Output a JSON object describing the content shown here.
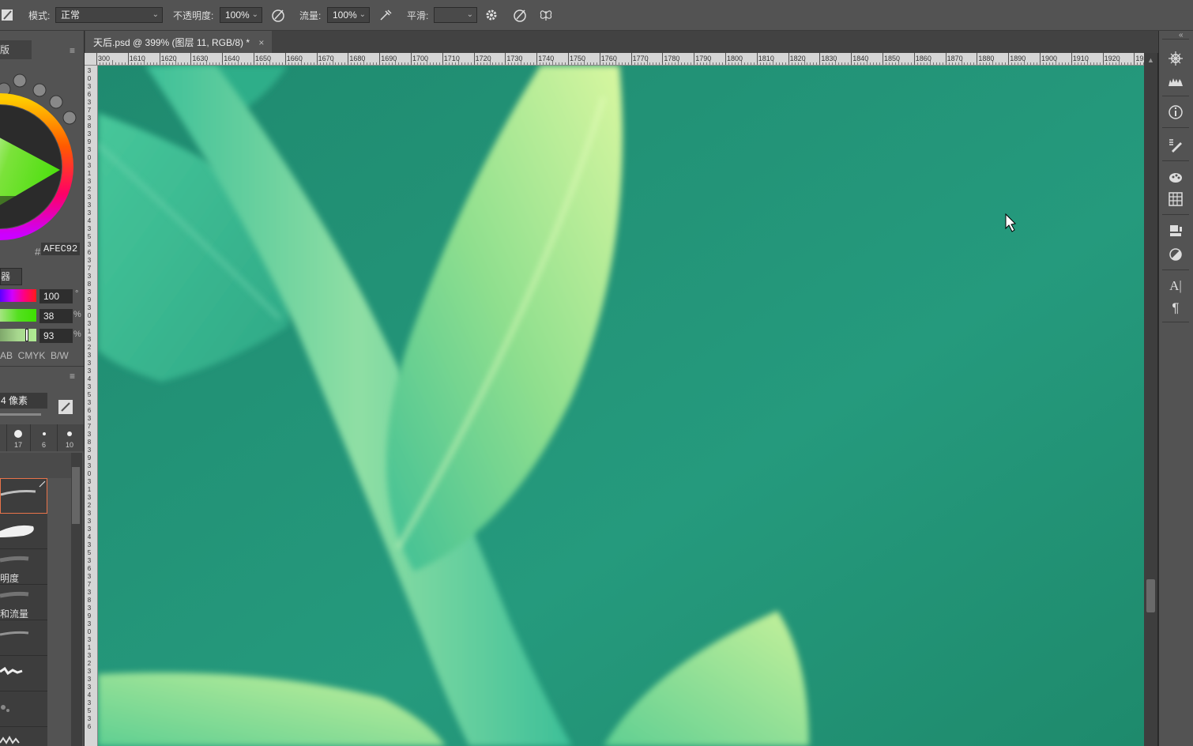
{
  "options_bar": {
    "mode_label": "模式:",
    "mode_value": "正常",
    "opacity_label": "不透明度:",
    "opacity_value": "100%",
    "flow_label": "流量:",
    "flow_value": "100%",
    "smoothing_label": "平滑:",
    "smoothing_value": ""
  },
  "document_tab": {
    "title": "天后.psd @ 399% (图层 11, RGB/8) *",
    "close": "×"
  },
  "ruler": {
    "h_labels": [
      "300",
      "1610",
      "1620",
      "1630",
      "1640",
      "1650",
      "1660",
      "1670",
      "1680",
      "1690",
      "1700",
      "1710",
      "1720",
      "1730",
      "1740",
      "1750",
      "1760",
      "1770",
      "1780",
      "1790",
      "1800",
      "1810",
      "1820",
      "1830",
      "1840",
      "1850",
      "1860",
      "1870",
      "1880",
      "1890",
      "1900",
      "1910",
      "1920",
      "193"
    ],
    "v_labels": [
      "3",
      "0",
      "3",
      "6",
      "3",
      "7",
      "3",
      "8",
      "3",
      "9",
      "3",
      "0",
      "3",
      "1",
      "3",
      "2",
      "3",
      "3",
      "3",
      "4",
      "3",
      "5",
      "3",
      "6",
      "3",
      "7",
      "3",
      "8",
      "3",
      "9",
      "3",
      "0",
      "3",
      "1",
      "3",
      "2",
      "3",
      "3",
      "3",
      "4",
      "3",
      "5",
      "3",
      "6",
      "3",
      "7",
      "3",
      "8",
      "3",
      "9",
      "3",
      "0",
      "3",
      "1",
      "3",
      "2",
      "3",
      "3",
      "3",
      "4",
      "3",
      "5",
      "3",
      "6",
      "3",
      "7",
      "3",
      "8",
      "3",
      "9",
      "3",
      "0",
      "3",
      "1",
      "3",
      "2",
      "3",
      "3",
      "3",
      "4",
      "3",
      "5",
      "3",
      "6"
    ]
  },
  "left_panel": {
    "color_tab_label": "版",
    "hex_prefix": "#",
    "hex_value": "AFEC92",
    "slider_tab_label": "器",
    "hue_value": "100",
    "hue_unit": "°",
    "saturation_value": "38",
    "saturation_unit": "%",
    "brightness_value": "93",
    "brightness_unit": "%",
    "color_modes": "AB  CMYK  B/W",
    "brush_size": "4 像素",
    "brush_presets": [
      "17",
      "6",
      "10"
    ],
    "brush_names": [
      "明度",
      "和流量"
    ]
  },
  "colors": {
    "ui_bg": "#535353",
    "canvas_bg": "#24957a",
    "leaf_light": "#c9f29a",
    "leaf_mid": "#6fd49a",
    "stem": "#4fc49a"
  }
}
